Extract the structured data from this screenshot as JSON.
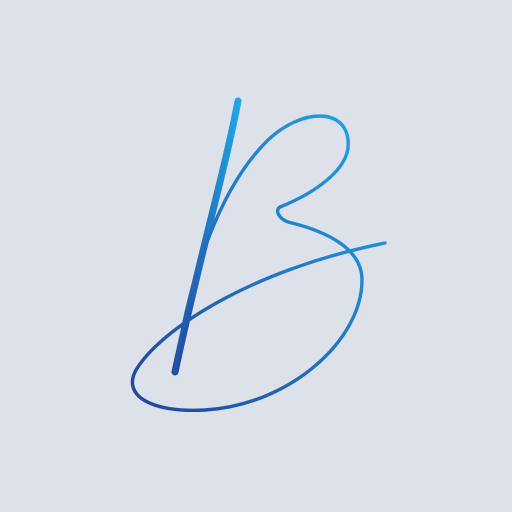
{
  "logo": {
    "icon": "script-b-logo-icon",
    "colors": {
      "background": "#dde2ea",
      "gradient_start": "#22449c",
      "gradient_end": "#21a6e6"
    }
  }
}
